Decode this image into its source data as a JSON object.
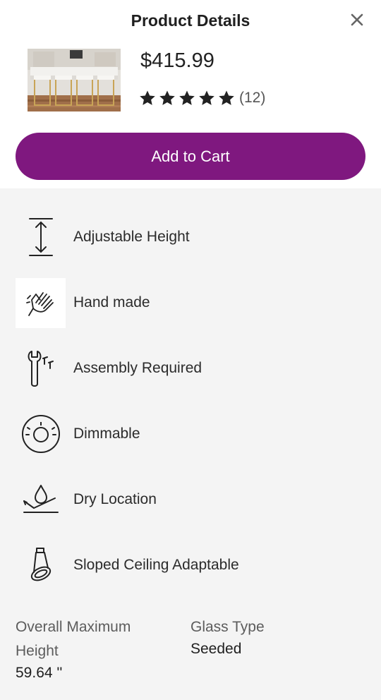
{
  "header": {
    "title": "Product Details"
  },
  "product": {
    "price": "$415.99",
    "rating_stars": 5,
    "rating_count": "(12)"
  },
  "actions": {
    "add_to_cart": "Add to Cart"
  },
  "features": [
    {
      "label": "Adjustable Height",
      "icon": "adjustable-height-icon"
    },
    {
      "label": "Hand made",
      "icon": "hand-made-icon"
    },
    {
      "label": "Assembly Required",
      "icon": "assembly-tools-icon"
    },
    {
      "label": "Dimmable",
      "icon": "dimmer-dial-icon"
    },
    {
      "label": "Dry Location",
      "icon": "dry-location-icon"
    },
    {
      "label": "Sloped Ceiling Adaptable",
      "icon": "sloped-ceiling-icon"
    }
  ],
  "specs": [
    {
      "label": "Overall Maximum Height",
      "value": "59.64 ''"
    },
    {
      "label": "Glass Type",
      "value": "Seeded"
    }
  ],
  "colors": {
    "accent": "#7f187f",
    "panel": "#f4f4f4"
  }
}
